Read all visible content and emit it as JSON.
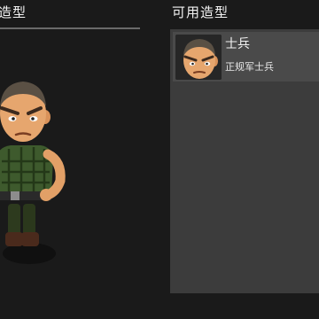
{
  "current_outfit": {
    "title": "造型"
  },
  "available_outfits": {
    "title": "可用造型",
    "items": [
      {
        "name": "士兵",
        "description": "正规军士兵"
      }
    ]
  }
}
